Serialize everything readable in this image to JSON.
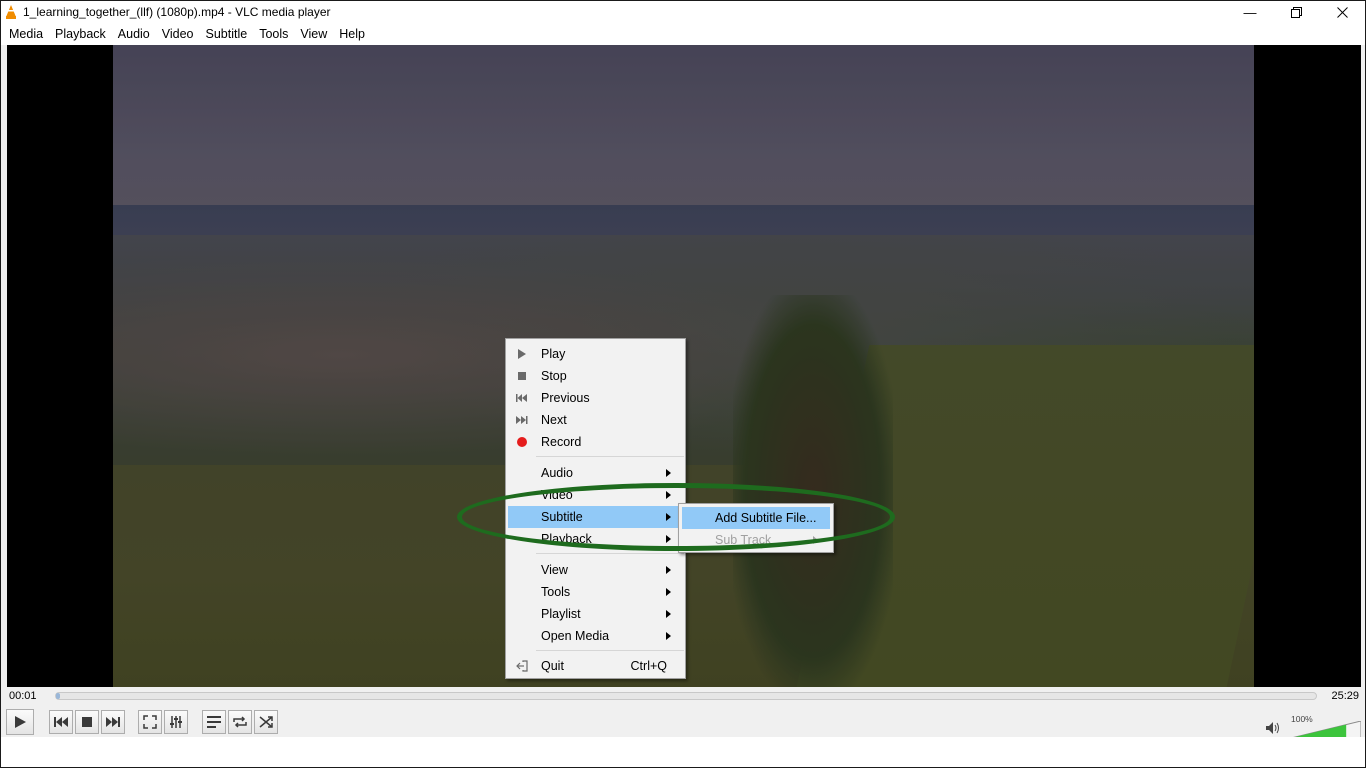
{
  "window": {
    "title": "1_learning_together_(llf) (1080p).mp4 - VLC media player",
    "controls": [
      "minimize-icon",
      "restore-icon",
      "close-icon"
    ]
  },
  "menubar": {
    "items": [
      "Media",
      "Playback",
      "Audio",
      "Video",
      "Subtitle",
      "Tools",
      "View",
      "Help"
    ]
  },
  "context_menu": {
    "play": "Play",
    "stop": "Stop",
    "previous": "Previous",
    "next": "Next",
    "record": "Record",
    "audio": "Audio",
    "video": "Video",
    "subtitle": "Subtitle",
    "playback": "Playback",
    "view": "View",
    "tools": "Tools",
    "playlist": "Playlist",
    "open_media": "Open Media",
    "quit": "Quit",
    "quit_shortcut": "Ctrl+Q"
  },
  "subtitle_submenu": {
    "add_file": "Add Subtitle File...",
    "sub_track": "Sub Track"
  },
  "player": {
    "elapsed": "00:01",
    "duration": "25:29",
    "progress_fraction": 0.001,
    "volume_label": "100%",
    "volume_fraction": 0.8
  },
  "colors": {
    "menu_highlight": "#91c9f7",
    "annotation": "#1e6b1e",
    "record": "#e51c1c",
    "volume_fill": "#3cc43c"
  }
}
